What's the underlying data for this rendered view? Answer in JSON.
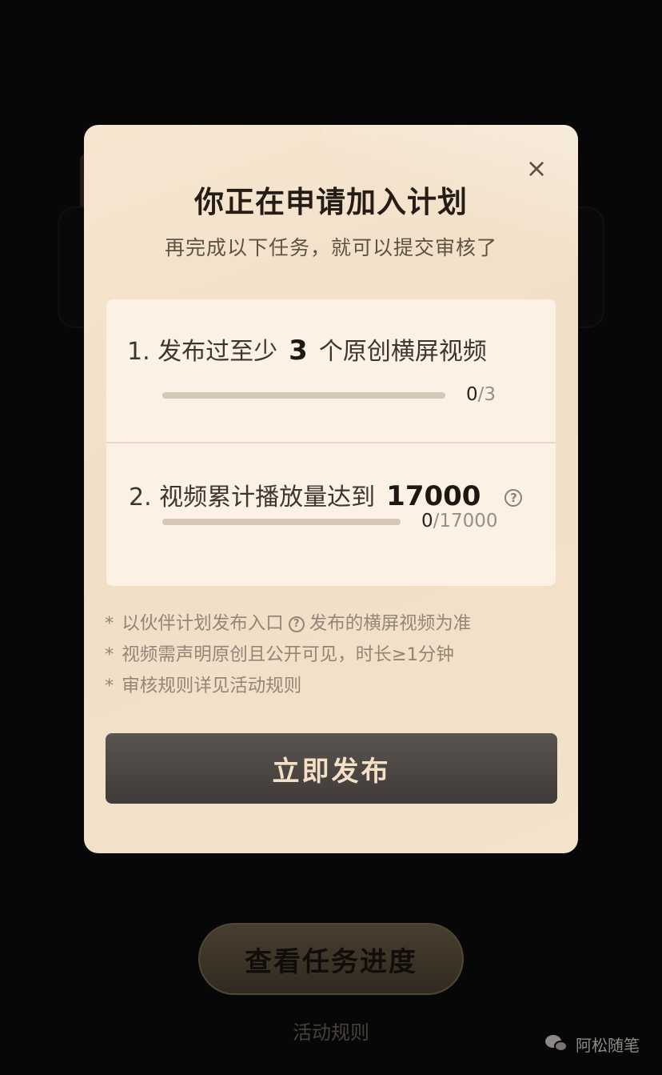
{
  "background": {
    "progress_button_label": "查看任务进度",
    "rules_link": "活动规则",
    "watermark": "阿松随笔"
  },
  "modal": {
    "close_label": "×",
    "title": "你正在申请加入计划",
    "subtitle": "再完成以下任务，就可以提交审核了",
    "tasks": [
      {
        "prefix": "1. 发布过至少",
        "number": "3",
        "suffix": "个原创横屏视频",
        "progress_current": "0",
        "progress_total": "/3",
        "progress_fraction": 0
      },
      {
        "prefix": "2. 视频累计播放量达到",
        "number": "17000",
        "suffix": "",
        "progress_current": "0",
        "progress_total": "/17000",
        "progress_fraction": 0
      }
    ],
    "notes": [
      {
        "star": "*",
        "before": "以伙伴计划发布入口",
        "after": "发布的横屏视频为准"
      },
      {
        "star": "*",
        "text": "视频需声明原创且公开可见，时长≥1分钟"
      },
      {
        "star": "*",
        "text": "审核规则详见活动规则"
      }
    ],
    "help_glyph": "?",
    "publish_button_label": "立即发布"
  },
  "colors": {
    "modal_bg": "#f3e2cc",
    "publish_button": "#4a4541",
    "publish_text": "#f3e0c6",
    "progress_button": "#5e5140"
  }
}
